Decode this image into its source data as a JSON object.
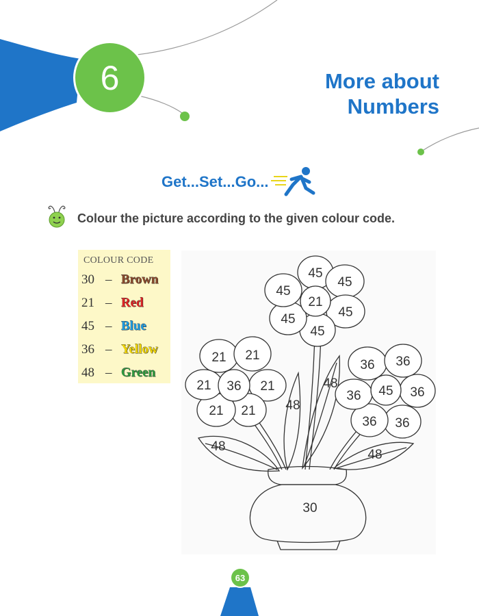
{
  "chapter": {
    "number": "6",
    "title_line1": "More about",
    "title_line2": "Numbers",
    "accent_color": "#1f75c8",
    "badge_color": "#6cc24a"
  },
  "section": {
    "heading": "Get...Set...Go...",
    "icon": "running-man-icon"
  },
  "activity": {
    "icon": "smiley-bug-icon",
    "instruction": "Colour the picture according to the given colour code."
  },
  "colour_code": {
    "title": "COLOUR CODE",
    "rows": [
      {
        "number": "30",
        "dash": "–",
        "colour": "Brown",
        "hex": "#8b4a2b"
      },
      {
        "number": "21",
        "dash": "–",
        "colour": "Red",
        "hex": "#e02424"
      },
      {
        "number": "45",
        "dash": "–",
        "colour": "Blue",
        "hex": "#1d9be0"
      },
      {
        "number": "36",
        "dash": "–",
        "colour": "Yellow",
        "hex": "#f2d600"
      },
      {
        "number": "48",
        "dash": "–",
        "colour": "Green",
        "hex": "#2e9c3e"
      }
    ]
  },
  "picture": {
    "flower_top": {
      "centre": "21",
      "petals": [
        "45",
        "45",
        "45",
        "45",
        "45",
        "45"
      ]
    },
    "flower_left": {
      "centre": "36",
      "petals": [
        "21",
        "21",
        "21",
        "21",
        "21",
        "21"
      ]
    },
    "flower_right": {
      "centre": "45",
      "petals": [
        "36",
        "36",
        "36",
        "36",
        "36",
        "36"
      ]
    },
    "leaves": [
      "48",
      "48",
      "48",
      "48"
    ],
    "vase": "30"
  },
  "page_number": "63"
}
